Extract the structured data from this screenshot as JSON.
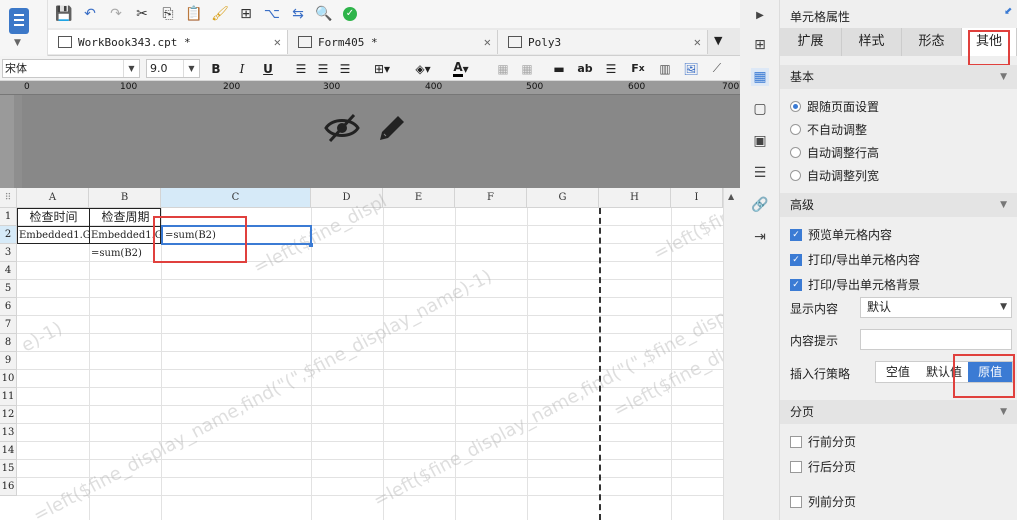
{
  "tabs": [
    {
      "label": "WorkBook343.cpt *",
      "active": true
    },
    {
      "label": "Form405 *",
      "active": false
    },
    {
      "label": "Poly3",
      "active": false
    }
  ],
  "format": {
    "font_name": "宋体",
    "font_size": "9.0",
    "bold": "B",
    "italic": "I",
    "underline": "U"
  },
  "ruler_marks": [
    "0",
    "100",
    "200",
    "300",
    "400",
    "500",
    "600",
    "700"
  ],
  "columns": [
    "A",
    "B",
    "C",
    "D",
    "E",
    "F",
    "G",
    "H",
    "I"
  ],
  "rows": [
    "1",
    "2",
    "3",
    "4",
    "5",
    "6",
    "7",
    "8",
    "9",
    "10",
    "11",
    "12",
    "13",
    "14",
    "15",
    "16"
  ],
  "cells": {
    "a1": "检查时间",
    "b1": "检查周期",
    "a2": "Embedded1.G",
    "b2": "Embedded1.G",
    "c2": "=sum(B2)",
    "b3": "=sum(B2)"
  },
  "watermark": {
    "w1": "=left($fine_display_name,find(\"(\",$fine_display_name)-1)",
    "w2": "=left($fine_display_name,find(\"(\",$fine_display_name)-1)",
    "w3": "=left($fine_display_name,find(\"(\",$fine_display_name)-1)",
    "w4": "e)-1)",
    "w5": "=left($fin",
    "w6": "=left($fine_displ"
  },
  "panel": {
    "title": "单元格属性",
    "tabs": [
      "扩展",
      "样式",
      "形态",
      "其他"
    ],
    "active_tab": "其他",
    "basic": {
      "title": "基本",
      "options": [
        "跟随页面设置",
        "不自动调整",
        "自动调整行高",
        "自动调整列宽"
      ],
      "selected": "跟随页面设置"
    },
    "advanced": {
      "title": "高级",
      "checks": [
        "预览单元格内容",
        "打印/导出单元格内容",
        "打印/导出单元格背景"
      ],
      "display_label": "显示内容",
      "display_value": "默认",
      "tooltip_label": "内容提示",
      "tooltip_value": "",
      "insert_label": "插入行策略",
      "insert_options": [
        "空值",
        "默认值",
        "原值"
      ],
      "insert_selected": "原值"
    },
    "paging": {
      "title": "分页",
      "checks": [
        "行前分页",
        "行后分页",
        "列前分页"
      ]
    }
  },
  "colors": {
    "accent": "#3b7bd4",
    "highlight": "#e0403d"
  }
}
